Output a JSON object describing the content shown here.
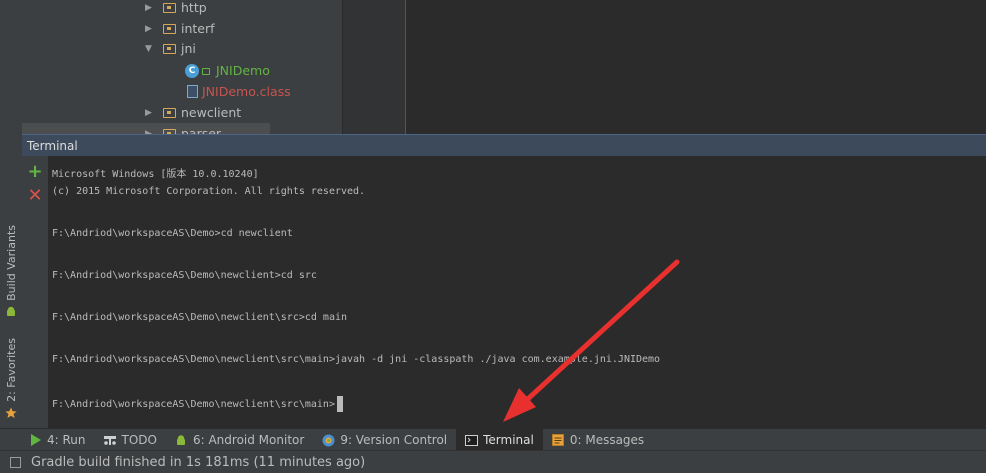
{
  "project_tree": {
    "items": [
      {
        "label": "http",
        "kind": "folder",
        "expanded": false
      },
      {
        "label": "interf",
        "kind": "folder",
        "expanded": false
      },
      {
        "label": "jni",
        "kind": "folder",
        "expanded": true
      },
      {
        "label": "JNIDemo",
        "kind": "class",
        "color": "#62b543"
      },
      {
        "label": "JNIDemo.class",
        "kind": "file",
        "color": "#c75450"
      },
      {
        "label": "newclient",
        "kind": "folder",
        "expanded": false
      },
      {
        "label": "parser",
        "kind": "folder",
        "expanded": false
      }
    ]
  },
  "side_tabs": {
    "build_variants": "Build Variants",
    "favorites": "2: Favorites"
  },
  "terminal": {
    "title": "Terminal",
    "lines": [
      "Microsoft Windows [版本 10.0.10240]",
      "(c) 2015 Microsoft Corporation. All rights reserved.",
      "F:\\Andriod\\workspaceAS\\Demo>cd newclient",
      "F:\\Andriod\\workspaceAS\\Demo\\newclient>cd src",
      "F:\\Andriod\\workspaceAS\\Demo\\newclient\\src>cd main",
      "F:\\Andriod\\workspaceAS\\Demo\\newclient\\src\\main>javah -d jni -classpath ./java com.example.jni.JNIDemo",
      "F:\\Andriod\\workspaceAS\\Demo\\newclient\\src\\main>"
    ]
  },
  "tool_tabs": [
    {
      "label": "4: Run",
      "icon": "run-icon"
    },
    {
      "label": "TODO",
      "icon": "todo-icon"
    },
    {
      "label": "6: Android Monitor",
      "icon": "android-icon"
    },
    {
      "label": "9: Version Control",
      "icon": "version-control-icon"
    },
    {
      "label": "Terminal",
      "icon": "terminal-icon",
      "active": true
    },
    {
      "label": "0: Messages",
      "icon": "messages-icon"
    }
  ],
  "status": {
    "text": "Gradle build finished in 1s 181ms (11 minutes ago)"
  },
  "colors": {
    "accent_arrow": "#e8312f",
    "class_green": "#62b543",
    "file_red": "#c75450"
  }
}
